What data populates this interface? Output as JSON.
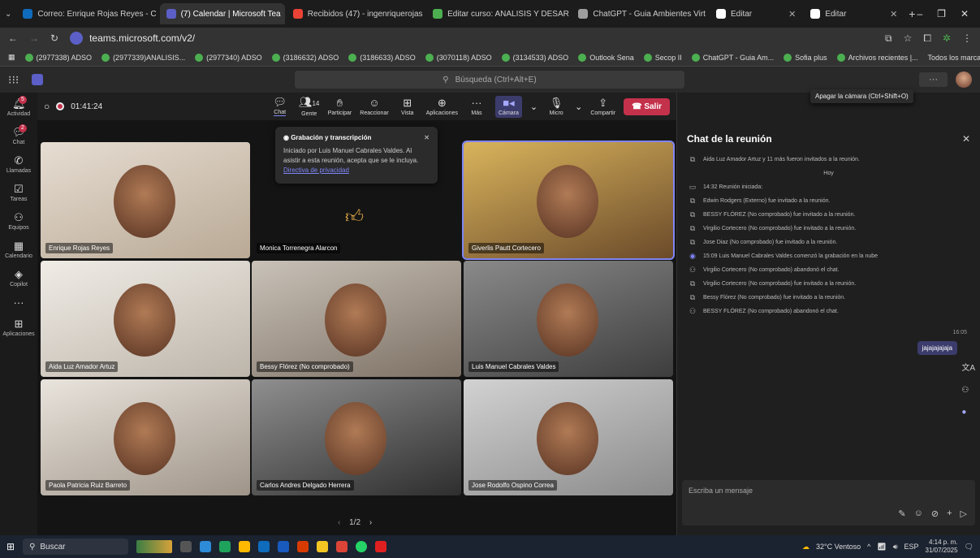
{
  "browser": {
    "tabs": [
      {
        "label": "Correo: Enrique Rojas Reyes - C",
        "color": "#0f6cbd"
      },
      {
        "label": "(7) Calendar | Microsoft Tea",
        "color": "#5b5fc7",
        "active": true
      },
      {
        "label": "Recibidos (47) - ingenriquerojas",
        "color": "#ea4335"
      },
      {
        "label": "Editar curso: ANALISIS Y DESAR",
        "color": "#4caf50"
      },
      {
        "label": "ChatGPT - Guia Ambientes Virt",
        "color": "#9e9e9e"
      },
      {
        "label": "Editar",
        "color": "#ffffff"
      },
      {
        "label": "Editar",
        "color": "#ffffff"
      }
    ],
    "url": "teams.microsoft.com/v2/",
    "bookmarks": [
      "(2977338) ADSO",
      "(2977339)ANALISIS...",
      "(2977340) ADSO",
      "(3186632) ADSO",
      "(3186633) ADSO",
      "(3070118) ADSO",
      "(3134533) ADSO",
      "Outlook Sena",
      "Secop II",
      "ChatGPT - Guia Am...",
      "Sofia plus",
      "Archivos recientes |..."
    ],
    "all_bookmarks": "Todos los marcadores"
  },
  "teams": {
    "search_placeholder": "Búsqueda (Ctrl+Alt+E)",
    "rail": [
      {
        "label": "Actividad",
        "icon": "bell-icon",
        "badge": "5"
      },
      {
        "label": "Chat",
        "icon": "chat-icon",
        "badge": "2"
      },
      {
        "label": "Llamadas",
        "icon": "phone-icon"
      },
      {
        "label": "Tareas",
        "icon": "tasks-icon"
      },
      {
        "label": "Equipos",
        "icon": "teams-icon"
      },
      {
        "label": "Calendario",
        "icon": "calendar-icon"
      },
      {
        "label": "Copilot",
        "icon": "copilot-icon"
      },
      {
        "label": "...",
        "icon": "more-icon"
      },
      {
        "label": "Aplicaciones",
        "icon": "apps-icon"
      }
    ]
  },
  "meeting": {
    "timer": "01:41:24",
    "toolbar": {
      "chat": "Chat",
      "people": "Gente",
      "people_count": "14",
      "participate": "Participar",
      "react": "Reaccionar",
      "view": "Vista",
      "apps": "Aplicaciones",
      "more": "Más",
      "camera": "Cámara",
      "mic": "Micro",
      "share": "Compartir",
      "leave": "Salir"
    },
    "tooltip": "Apagar la cámara (Ctrl+Shift+O)",
    "recording_notice": {
      "title": "Grabación y transcripción",
      "body": "Iniciado por Luis Manuel Cabrales Valdes. Al asistir a esta reunión, acepta que se le incluya.",
      "link": "Directiva de privacidad"
    },
    "participants": [
      "Enrique Rojas Reyes",
      "Monica Torrenegra Alarcon",
      "Giverlis Pautt Cortecero",
      "Aida Luz Amador Artuz",
      "Bessy Flórez (No comprobado)",
      "Luis Manuel Cabrales Valdes",
      "Paola Patricia Ruiz Barreto",
      "Carlos Andres Delgado Herrera",
      "Jose Rodolfo Ospino Correa"
    ],
    "pager": "1/2"
  },
  "chat": {
    "title": "Chat de la reunión",
    "events": [
      {
        "icon": "invite-icon",
        "text": "Aida Luz Amador Artuz y 11 más fueron invitados a la reunión."
      },
      {
        "icon": "",
        "text": "Hoy"
      },
      {
        "icon": "meeting-icon",
        "text": "14:32   Reunión iniciada:"
      },
      {
        "icon": "invite-icon",
        "text": "Edwin Rodgers (Externo) fue invitado a la reunión."
      },
      {
        "icon": "invite-icon",
        "text": "BESSY FLÓREZ (No comprobado) fue invitado a la reunión."
      },
      {
        "icon": "invite-icon",
        "text": "Virgilio Cortecero (No comprobado) fue invitado a la reunión."
      },
      {
        "icon": "invite-icon",
        "text": "Jose Diaz (No comprobado) fue invitado a la reunión."
      },
      {
        "icon": "record-icon",
        "text": "15:09   Luis Manuel Cabrales Valdes comenzó la grabación en la nube"
      },
      {
        "icon": "leave-icon",
        "text": "Virgilio Cortecero (No comprobado) abandonó el chat."
      },
      {
        "icon": "invite-icon",
        "text": "Virgilio Cortecero (No comprobado) fue invitado a la reunión."
      },
      {
        "icon": "invite-icon",
        "text": "Bessy Flórez (No comprobado) fue invitado a la reunión."
      },
      {
        "icon": "leave-icon",
        "text": "BESSY FLÓREZ (No comprobado) abandonó el chat."
      }
    ],
    "message_time": "16:05",
    "message": "jajajajajaja",
    "composer_placeholder": "Escriba un mensaje"
  },
  "taskbar": {
    "search": "Buscar",
    "weather": "32°C  Ventoso",
    "lang": "ESP",
    "time": "4:14 p. m.",
    "date": "31/07/2025"
  }
}
